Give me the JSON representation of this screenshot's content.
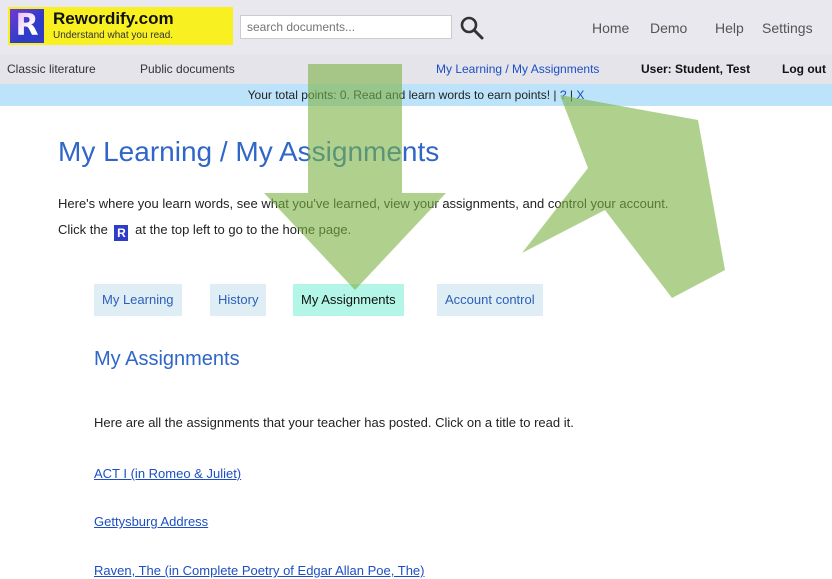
{
  "header": {
    "logo": {
      "letter": "R",
      "title": "Rewordify.com",
      "tagline": "Understand what you read."
    },
    "search": {
      "placeholder": "search documents..."
    },
    "nav": [
      "Home",
      "Demo",
      "Help",
      "Settings"
    ]
  },
  "subbar": {
    "classic": "Classic literature",
    "public": "Public documents",
    "breadcrumb": "My Learning / My Assignments",
    "user": "User: Student, Test",
    "logout": "Log out"
  },
  "points": {
    "message": "Your total points: 0. Read and learn words to earn points!",
    "sep1": "|",
    "help": "?",
    "sep2": "|",
    "close": "X"
  },
  "main": {
    "title": "My Learning / My Assignments",
    "intro_line1": "Here's where you learn words, see what you've learned, view your assignments, and control your account.",
    "intro_before": "Click the",
    "intro_after": "at the top left to go to the home page.",
    "tabs": [
      "My Learning",
      "History",
      "My Assignments",
      "Account control"
    ],
    "active_tab": "My Assignments",
    "section_title": "My Assignments",
    "description": "Here are all the assignments that your teacher has posted. Click on a title to read it.",
    "assignments": [
      "ACT I (in Romeo & Juliet)",
      "Gettysburg Address",
      "Raven, The (in Complete Poetry of Edgar Allan Poe, The)"
    ]
  },
  "colors": {
    "accent": "#2f66c7",
    "link": "#1c4fc4",
    "logo_bg": "#f8f021",
    "points_bg": "#bde3fa",
    "active_tab": "#b3f5e6",
    "overlay_arrow": "#7cb342"
  },
  "icons": {
    "search": "search-icon",
    "overlay": [
      "arrow-down-overlay",
      "arrow-up-right-overlay"
    ]
  }
}
